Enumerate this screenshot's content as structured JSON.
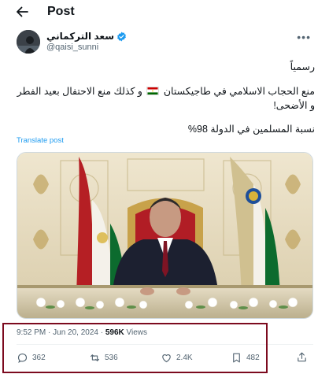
{
  "header": {
    "title": "Post"
  },
  "author": {
    "name": "سعد التركماني",
    "handle": "@qaisi_sunni",
    "verified_icon": "verified-badge-icon"
  },
  "tweet": {
    "line1": "رسمياً",
    "line2": "منع الحجاب الاسلامي في طاجيكستان",
    "line2b": "و كذلك منع الاحتفال بعيد الفطر و الأضحى!",
    "line3": "نسبة المسلمين في الدولة 98%",
    "translate_label": "Translate post"
  },
  "meta": {
    "time": "9:52 PM · Jun 20, 2024 · ",
    "views_count": "596K",
    "views_label": " Views"
  },
  "actions": {
    "replies": "362",
    "reposts": "536",
    "likes": "2.4K",
    "bookmarks": "482"
  },
  "colors": {
    "accent": "#1d9bf0",
    "muted": "#536471",
    "highlight_border": "#7c0a1e"
  }
}
